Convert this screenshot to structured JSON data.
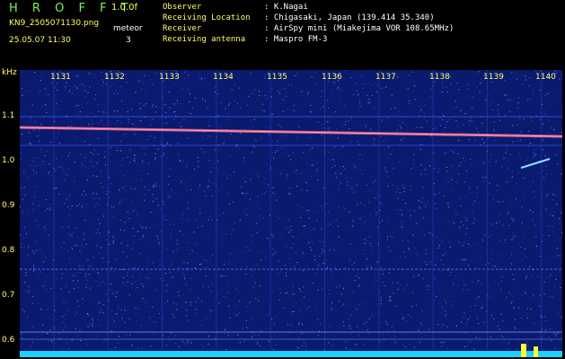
{
  "header": {
    "app_title": "H R O F F T",
    "version": "1.0.0f",
    "filename": "KN9_2505071130.png",
    "mode": "meteor",
    "datetime": "25.05.07 11:30",
    "number": "3"
  },
  "info": {
    "rows": [
      {
        "label": "Observer",
        "value": ": K.Nagai"
      },
      {
        "label": "Receiving Location",
        "value": ": Chigasaki, Japan (139.414 35.340)"
      },
      {
        "label": "Receiver",
        "value": ": AirSpy mini (Miakejima VOR 108.65MHz)"
      },
      {
        "label": "Receiving antenna",
        "value": ": Maspro FM-3"
      }
    ]
  },
  "axes": {
    "y_unit": "kHz",
    "y_ticks": [
      "1.1",
      "1.0",
      "0.9",
      "0.8",
      "0.7",
      "0.6"
    ],
    "x_ticks": [
      "1131",
      "1132",
      "1133",
      "1134",
      "1135",
      "1136",
      "1137",
      "1138",
      "1139",
      "1140"
    ]
  },
  "colors": {
    "background": "#0a1a6e",
    "noise": "#4a66ff",
    "carrier": "#ff6a8a",
    "meteor": "#8fe0ff",
    "floor": "#19d3ff",
    "text": "#ffff66"
  }
}
